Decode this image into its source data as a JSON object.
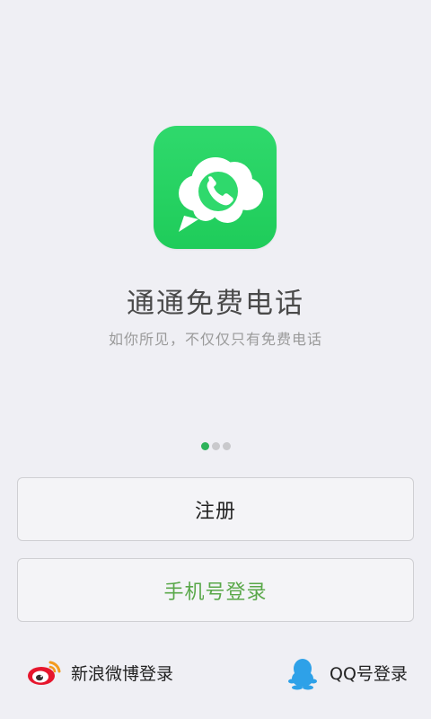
{
  "app": {
    "title": "通通免费电话",
    "subtitle": "如你所见，不仅仅只有免费电话"
  },
  "pager": {
    "count": 3,
    "active_index": 0
  },
  "buttons": {
    "register_label": "注册",
    "phone_login_label": "手机号登录"
  },
  "social": {
    "weibo_label": "新浪微博登录",
    "qq_label": "QQ号登录"
  },
  "icons": {
    "app": "cloud-phone-icon",
    "weibo": "weibo-icon",
    "qq": "qq-penguin-icon"
  },
  "colors": {
    "background": "#efeff4",
    "brand_green": "#2fd96c",
    "phone_login_text": "#5aa84a",
    "pager_active": "#2db35a",
    "pager_inactive": "#c9c9cc",
    "weibo_red": "#e6162d",
    "qq_blue": "#2ea1e8"
  }
}
